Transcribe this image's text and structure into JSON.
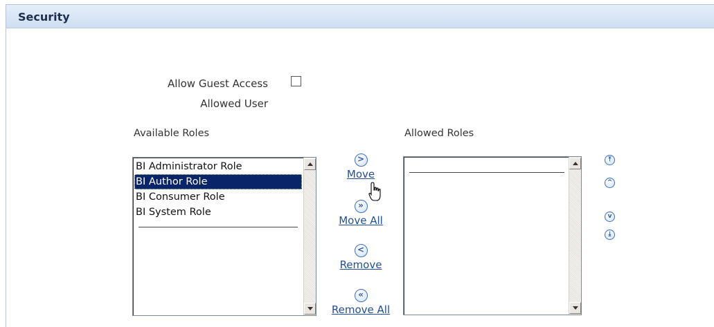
{
  "section": {
    "title": "Security"
  },
  "guest_access": {
    "label": "Allow Guest Access",
    "checked": false
  },
  "allowed_user": {
    "label": "Allowed User"
  },
  "available_roles": {
    "label": "Available Roles",
    "items": [
      {
        "label": "BI Administrator Role",
        "selected": false
      },
      {
        "label": "BI Author Role",
        "selected": true
      },
      {
        "label": "BI Consumer Role",
        "selected": false
      },
      {
        "label": "BI System Role",
        "selected": false
      }
    ]
  },
  "allowed_roles": {
    "label": "Allowed Roles",
    "items": []
  },
  "shuttle": {
    "move": {
      "label": "Move",
      "icon": "move-right-icon",
      "glyph": ">"
    },
    "move_all": {
      "label": "Move All",
      "icon": "move-all-right-icon",
      "glyph": "»"
    },
    "remove": {
      "label": "Remove",
      "icon": "remove-left-icon",
      "glyph": "<"
    },
    "remove_all": {
      "label": "Remove All",
      "icon": "remove-all-left-icon",
      "glyph": "«"
    }
  },
  "ordering": {
    "move_top": {
      "icon": "move-to-top-icon",
      "glyph": "⤒"
    },
    "move_up": {
      "icon": "move-up-icon",
      "glyph": "^"
    },
    "move_down": {
      "icon": "move-down-icon",
      "glyph": "v"
    },
    "move_bottom": {
      "icon": "move-to-bottom-icon",
      "glyph": "⤓"
    }
  },
  "colors": {
    "header_bg": "#d6e4f5",
    "link": "#1f4e99",
    "selection": "#0a246a",
    "icon_border": "#3d6fbf"
  }
}
